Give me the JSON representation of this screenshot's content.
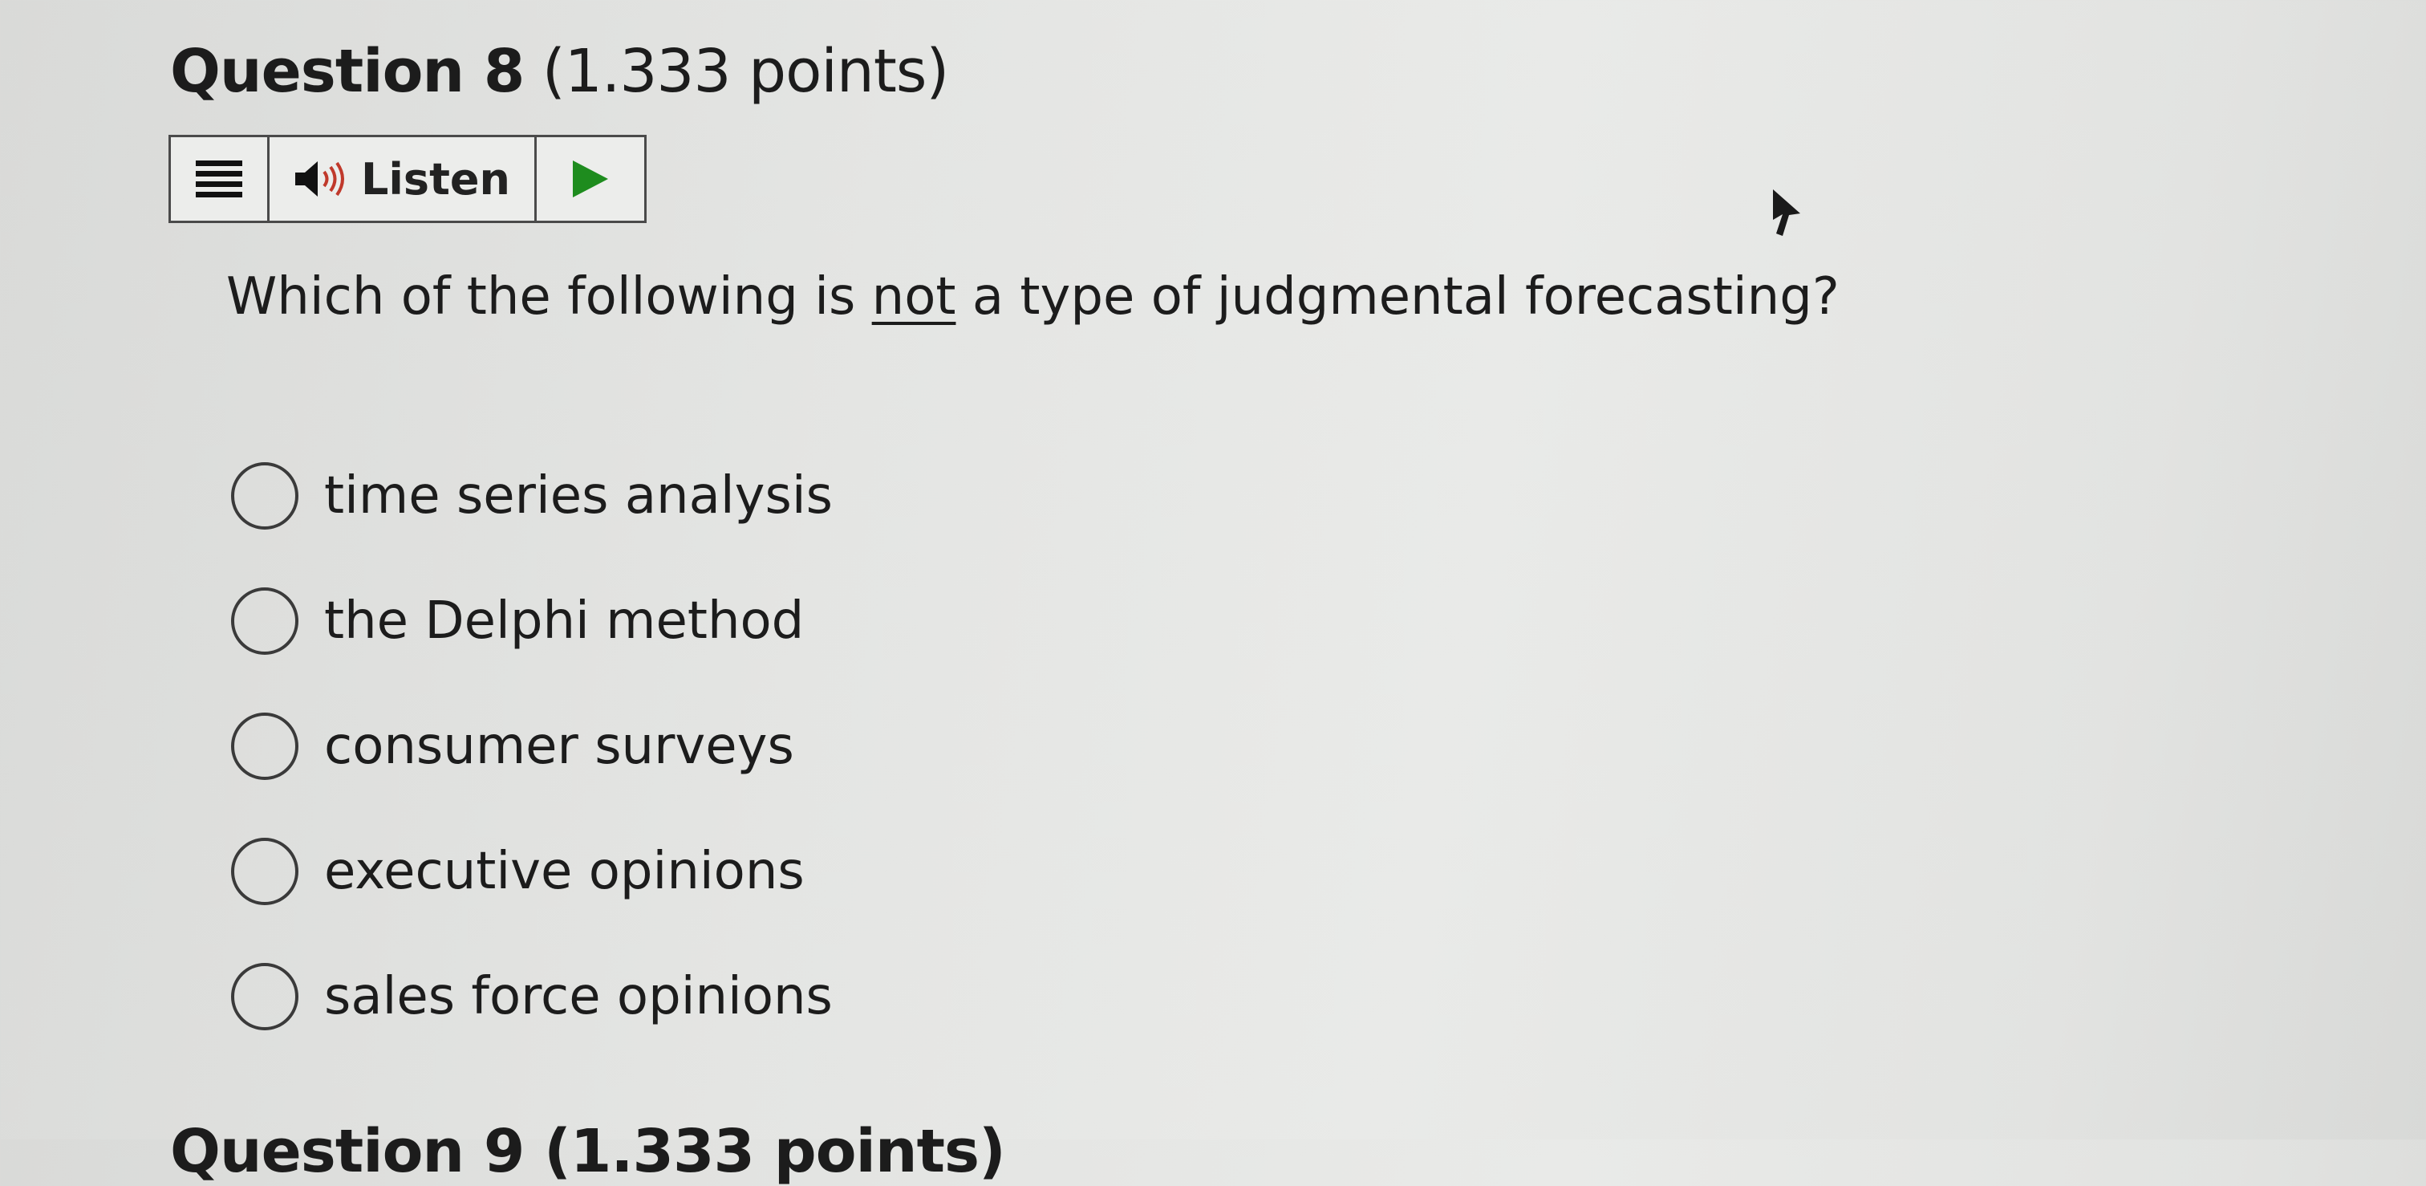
{
  "question": {
    "label": "Question 8",
    "points": "(1.333 points)",
    "prompt_before": "Which of the following is ",
    "prompt_emphasis": "not",
    "prompt_after": " a type of judgmental forecasting?"
  },
  "listen_toolbar": {
    "menu_icon": "menu-icon",
    "speaker_icon": "speaker-icon",
    "listen_label": "Listen",
    "play_icon": "play-icon",
    "play_color": "#1e8c1e"
  },
  "options": [
    {
      "label": "time series analysis",
      "selected": false
    },
    {
      "label": "the Delphi method",
      "selected": false
    },
    {
      "label": "consumer surveys",
      "selected": false
    },
    {
      "label": "executive opinions",
      "selected": false
    },
    {
      "label": "sales force opinions",
      "selected": false
    }
  ],
  "next_question_fragment": "Question 9 (1.333 points)"
}
